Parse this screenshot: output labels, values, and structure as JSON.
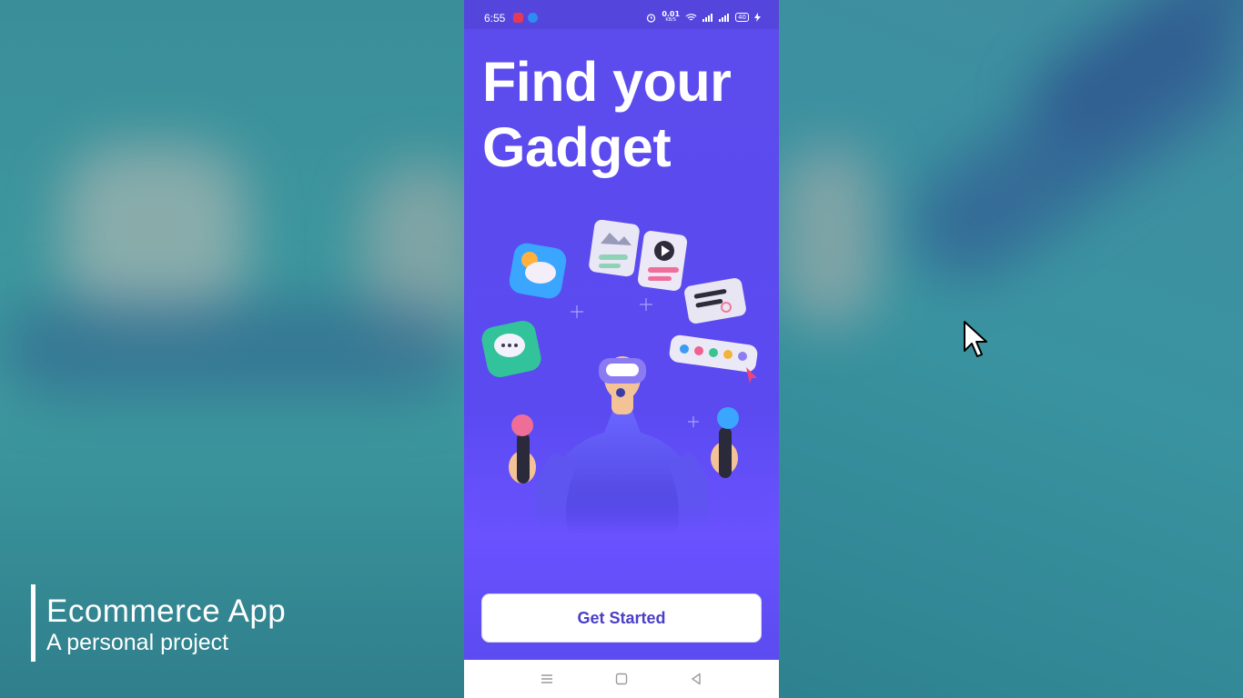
{
  "caption": {
    "title": "Ecommerce App",
    "subtitle": "A personal project"
  },
  "status_bar": {
    "time": "6:55",
    "net_speed": "0.01",
    "net_unit": "KB/S",
    "battery": "40"
  },
  "onboarding": {
    "headline_line1": "Find your",
    "headline_line2": "Gadget",
    "cta_label": "Get Started"
  },
  "nav": {
    "menu": "menu-icon",
    "home": "home-icon",
    "back": "back-icon"
  },
  "colors": {
    "primary": "#5b4bf0",
    "cta_text": "#4a3fc6",
    "background": "#3a9aa0"
  }
}
